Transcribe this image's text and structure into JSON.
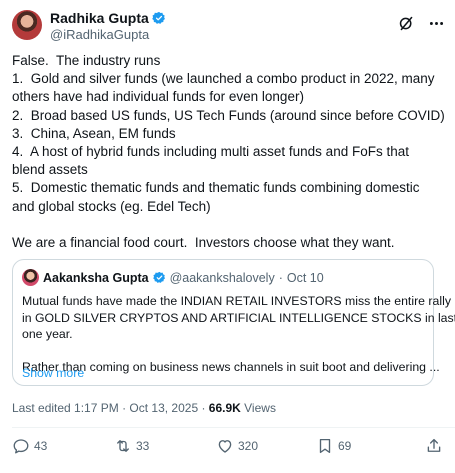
{
  "author": {
    "name": "Radhika Gupta",
    "handle": "@iRadhikaGupta"
  },
  "header_icons": [
    "grok-icon",
    "more-icon"
  ],
  "tweet_lines": [
    "False.  The industry runs",
    "1.  Gold and silver funds (we launched a combo product in 2022, many",
    "others have had individual funds for even longer)",
    "2.  Broad based US funds, US Tech Funds (around since before COVID)",
    "3.  China, Asean, EM funds",
    "4.  A host of hybrid funds including multi asset funds and FoFs that",
    "blend assets",
    "5.  Domestic thematic funds and thematic funds combining domestic",
    "and global stocks (eg. Edel Tech)",
    "",
    "We are a financial food court.  Investors choose what they want."
  ],
  "quote": {
    "name": "Aakanksha Gupta",
    "handle": "@aakankshalovely",
    "separator": "·",
    "date": "Oct 10",
    "lines": [
      "Mutual funds have made the INDIAN RETAIL INVESTORS miss the entire rally",
      "in GOLD SILVER CRYPTOS AND ARTIFICIAL INTELLIGENCE STOCKS in last",
      "one year.",
      "",
      "Rather than coming on business news channels in suit boot and delivering ..."
    ],
    "show_more": "Show more"
  },
  "meta": {
    "edited_prefix": "Last edited 1:17 PM · Oct 13, 2025 · ",
    "views_count": "66.9K",
    "views_label": " Views"
  },
  "actions": {
    "replies": "43",
    "reposts": "33",
    "likes": "320",
    "bookmarks": "69"
  },
  "colors": {
    "verified": "#1d9bf0",
    "link": "#1d9bf0",
    "muted": "#536471",
    "text": "#0f1419",
    "border": "#cfd9de"
  }
}
